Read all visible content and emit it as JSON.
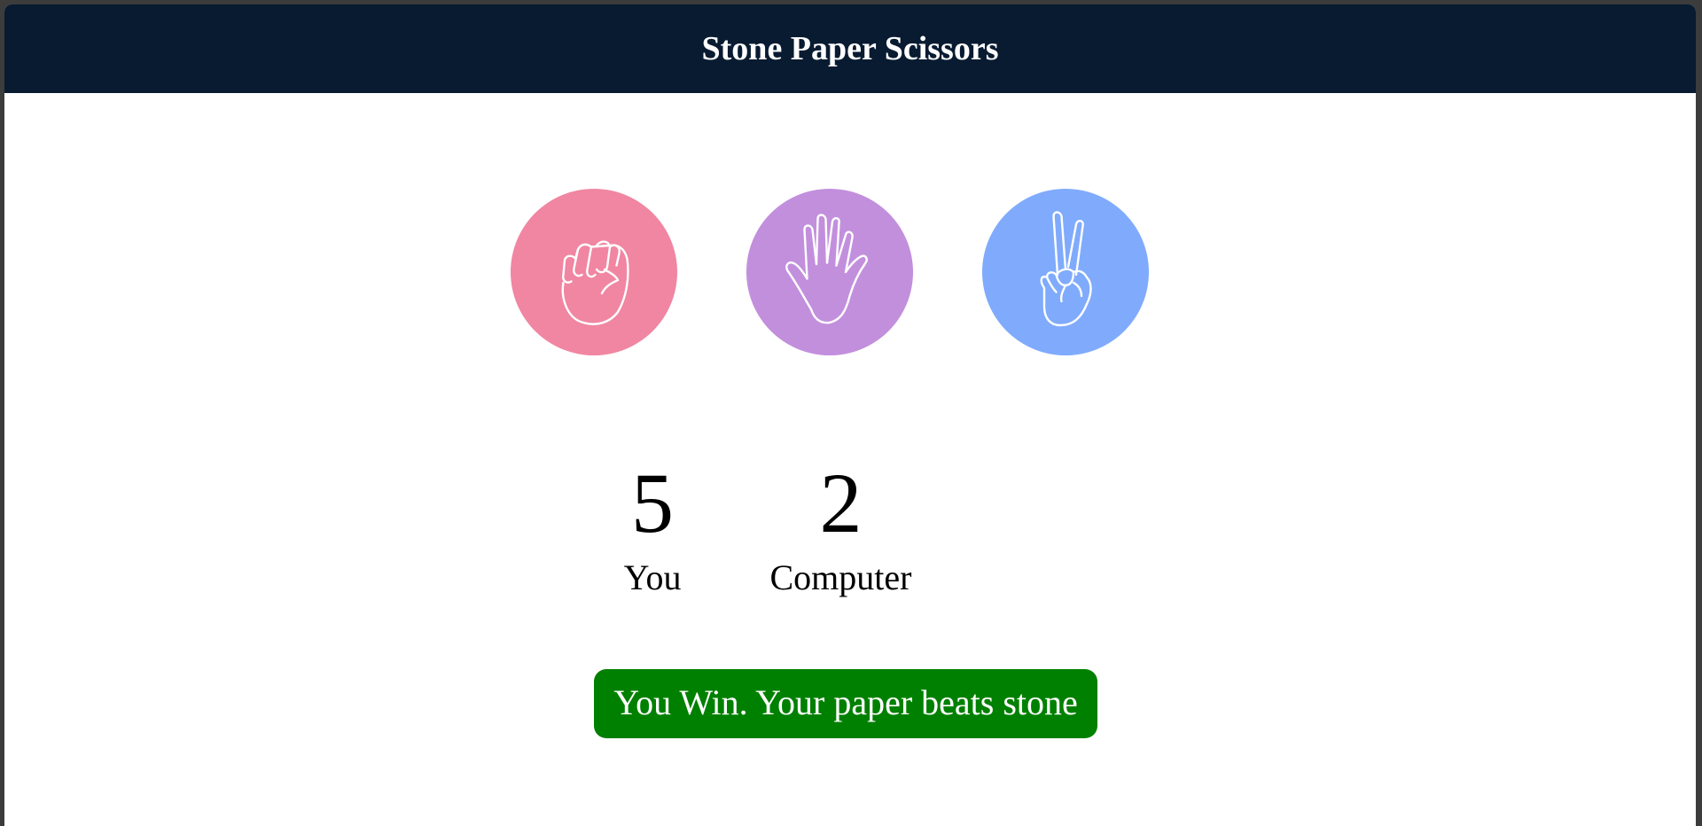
{
  "header": {
    "title": "Stone Paper Scissors"
  },
  "choices": [
    {
      "id": "stone",
      "icon": "fist-icon",
      "color": "#f086a2"
    },
    {
      "id": "paper",
      "icon": "open-hand-icon",
      "color": "#c28fdd"
    },
    {
      "id": "scissors",
      "icon": "victory-hand-icon",
      "color": "#80abfc"
    }
  ],
  "scoreboard": {
    "user": {
      "score": "5",
      "label": "You"
    },
    "computer": {
      "score": "2",
      "label": "Computer"
    }
  },
  "message": {
    "text": "You Win. Your paper beats stone",
    "color": "#008000"
  }
}
